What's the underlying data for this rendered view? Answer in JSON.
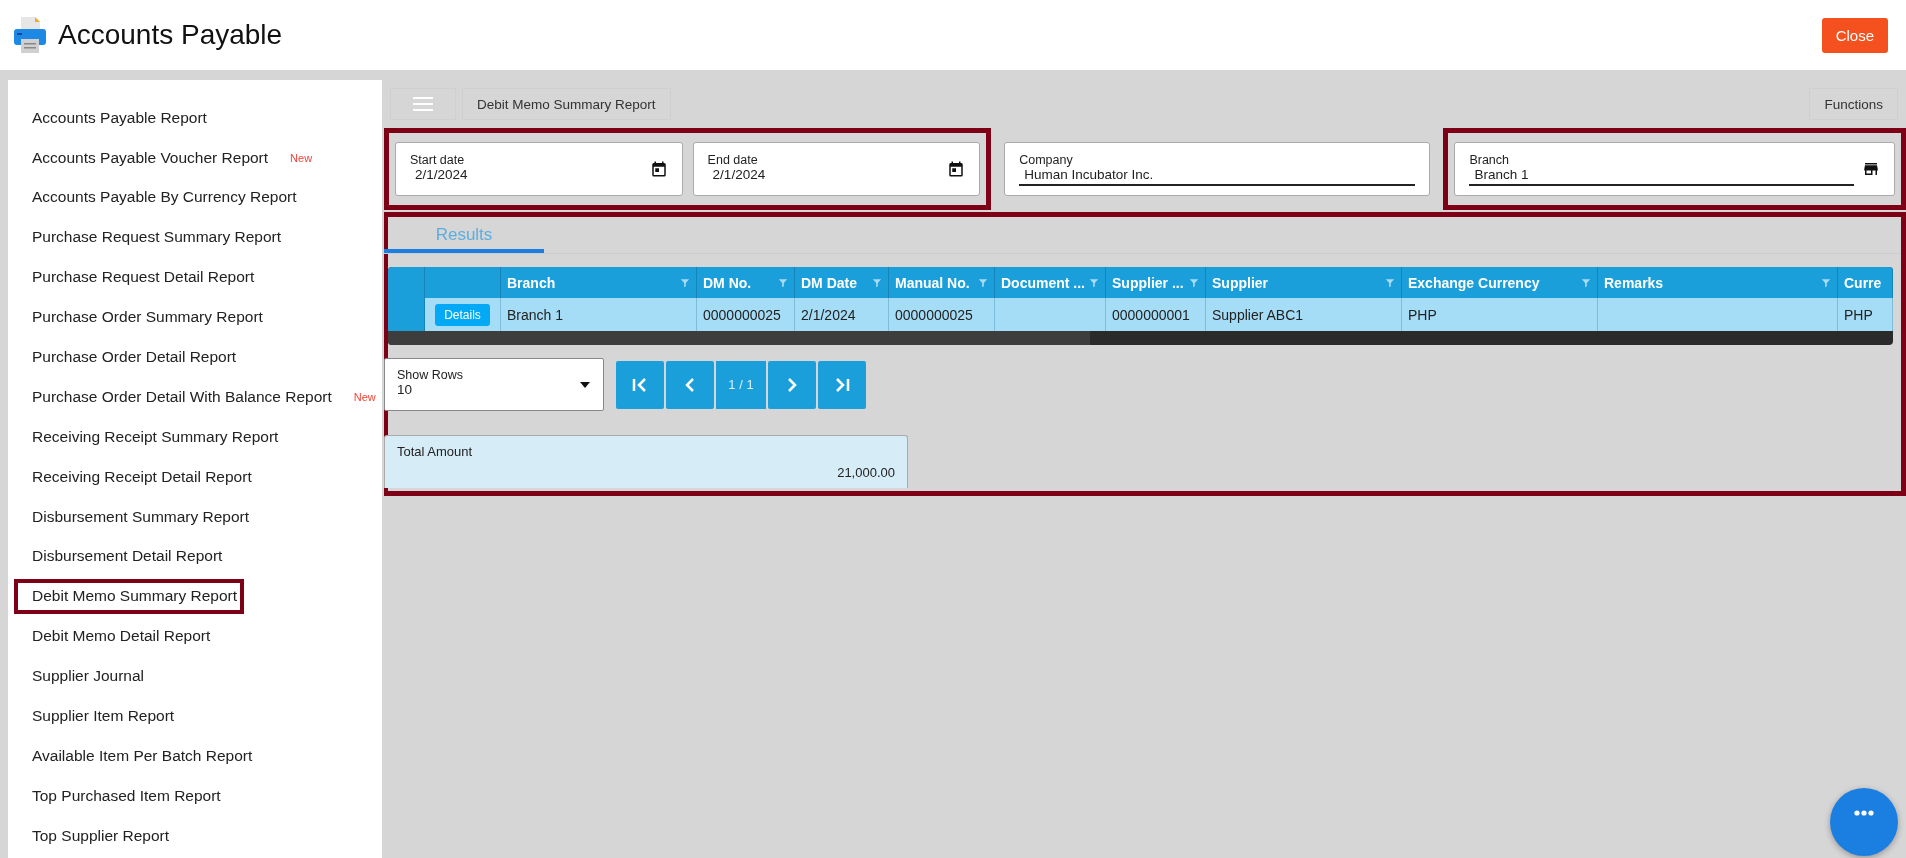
{
  "app": {
    "title": "Accounts Payable",
    "close_label": "Close"
  },
  "sidebar": {
    "items": [
      {
        "label": "Accounts Payable Report",
        "highlighted": false
      },
      {
        "label": "Accounts Payable Voucher Report",
        "badge": "New",
        "highlighted": false
      },
      {
        "label": "Accounts Payable By Currency Report",
        "highlighted": false
      },
      {
        "label": "Purchase Request Summary Report",
        "highlighted": false
      },
      {
        "label": "Purchase Request Detail Report",
        "highlighted": false
      },
      {
        "label": "Purchase Order Summary Report",
        "highlighted": false
      },
      {
        "label": "Purchase Order Detail Report",
        "highlighted": false
      },
      {
        "label": "Purchase Order Detail With Balance Report",
        "badge": "New",
        "highlighted": false
      },
      {
        "label": "Receiving Receipt Summary Report",
        "highlighted": false
      },
      {
        "label": "Receiving Receipt Detail Report",
        "highlighted": false
      },
      {
        "label": "Disbursement Summary Report",
        "highlighted": false
      },
      {
        "label": "Disbursement Detail Report",
        "highlighted": false
      },
      {
        "label": "Debit Memo Summary Report",
        "highlighted": true
      },
      {
        "label": "Debit Memo Detail Report",
        "highlighted": false
      },
      {
        "label": "Supplier Journal",
        "highlighted": false
      },
      {
        "label": "Supplier Item Report",
        "highlighted": false
      },
      {
        "label": "Available Item Per Batch Report",
        "highlighted": false
      },
      {
        "label": "Top Purchased Item Report",
        "highlighted": false
      },
      {
        "label": "Top Supplier Report",
        "highlighted": false
      }
    ]
  },
  "toolbar": {
    "title": "Debit Memo Summary Report",
    "functions_label": "Functions"
  },
  "filters": {
    "groups": [
      {
        "highlighted": true,
        "fields": [
          {
            "kind": "date",
            "label": "Start date",
            "value": "2/1/2024"
          },
          {
            "kind": "date",
            "label": "End date",
            "value": "2/1/2024"
          }
        ]
      },
      {
        "highlighted": false,
        "fields": [
          {
            "kind": "text",
            "label": "Company",
            "value": "Human Incubator Inc."
          }
        ]
      },
      {
        "highlighted": true,
        "fields": [
          {
            "kind": "store",
            "label": "Branch",
            "value": "Branch 1"
          }
        ]
      }
    ]
  },
  "results": {
    "highlighted": true,
    "tabs": [
      {
        "label": "Results",
        "selected": true
      }
    ],
    "table": {
      "columns": [
        {
          "label": "Branch",
          "filter": true
        },
        {
          "label": "DM No.",
          "filter": true
        },
        {
          "label": "DM Date",
          "filter": true
        },
        {
          "label": "Manual No.",
          "filter": true
        },
        {
          "label": "Document ...",
          "filter": true
        },
        {
          "label": "Supplier ...",
          "filter": true
        },
        {
          "label": "Supplier",
          "filter": true
        },
        {
          "label": "Exchange Currency",
          "filter": true
        },
        {
          "label": "Remarks",
          "filter": true
        },
        {
          "label": "Curre",
          "filter": false
        }
      ],
      "rows": [
        {
          "action": "Details",
          "cells": [
            "Branch 1",
            "0000000025",
            "2/1/2024",
            "0000000025",
            null,
            "0000000001",
            "Supplier ABC1",
            "PHP",
            null,
            "PHP"
          ]
        }
      ]
    },
    "show_rows": {
      "label": "Show Rows",
      "value": "10"
    },
    "pager": {
      "page": "1 / 1"
    },
    "total": {
      "label": "Total Amount",
      "value": "21,000.00"
    }
  }
}
